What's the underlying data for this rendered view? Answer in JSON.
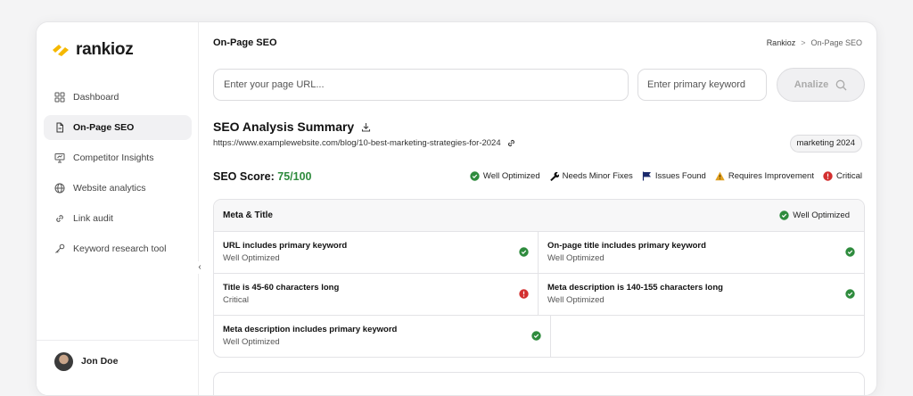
{
  "app": {
    "name": "rankioz",
    "brand_color": "#f5b800"
  },
  "sidebar": {
    "items": [
      {
        "label": "Dashboard",
        "icon": "dashboard-icon"
      },
      {
        "label": "On-Page SEO",
        "icon": "file-icon",
        "active": true
      },
      {
        "label": "Competitor Insights",
        "icon": "presentation-icon"
      },
      {
        "label": "Website analytics",
        "icon": "globe-icon"
      },
      {
        "label": "Link audit",
        "icon": "link-icon"
      },
      {
        "label": "Keyword research tool",
        "icon": "key-icon"
      }
    ],
    "collapse_glyph": "‹",
    "user": {
      "name": "Jon Doe"
    }
  },
  "header": {
    "title": "On-Page SEO",
    "breadcrumb": {
      "root": "Rankioz",
      "separator": ">",
      "current": "On-Page SEO"
    }
  },
  "search": {
    "url_placeholder": "Enter your page URL...",
    "keyword_placeholder": "Enter primary keyword",
    "analyze_label": "Analize"
  },
  "summary": {
    "title": "SEO Analysis Summary",
    "url": "https://www.examplewebsite.com/blog/10-best-marketing-strategies-for-2024",
    "keyword_badge": "marketing 2024",
    "score_label": "SEO Score:",
    "score_value": "75/100",
    "legend": [
      {
        "label": "Well Optimized",
        "icon": "check-circle-icon",
        "color": "#2e8b3d"
      },
      {
        "label": "Needs Minor Fixes",
        "icon": "wrench-icon",
        "color": "#111111"
      },
      {
        "label": "Issues Found",
        "icon": "flag-icon",
        "color": "#1a2a6c"
      },
      {
        "label": "Requires Improvement",
        "icon": "warning-icon",
        "color": "#e0a020"
      },
      {
        "label": "Critical",
        "icon": "alert-circle-icon",
        "color": "#d32f2f"
      }
    ]
  },
  "meta_card": {
    "title": "Meta & Title",
    "status": "Well Optimized",
    "checks": [
      {
        "title": "URL includes primary keyword",
        "status": "Well Optimized",
        "level": "ok"
      },
      {
        "title": "On-page title includes primary keyword",
        "status": "Well Optimized",
        "level": "ok"
      },
      {
        "title": "Title is 45-60 characters long",
        "status": "Critical",
        "level": "critical"
      },
      {
        "title": "Meta description is 140-155 characters long",
        "status": "Well Optimized",
        "level": "ok"
      },
      {
        "title": "Meta description includes primary keyword",
        "status": "Well Optimized",
        "level": "ok"
      }
    ]
  }
}
